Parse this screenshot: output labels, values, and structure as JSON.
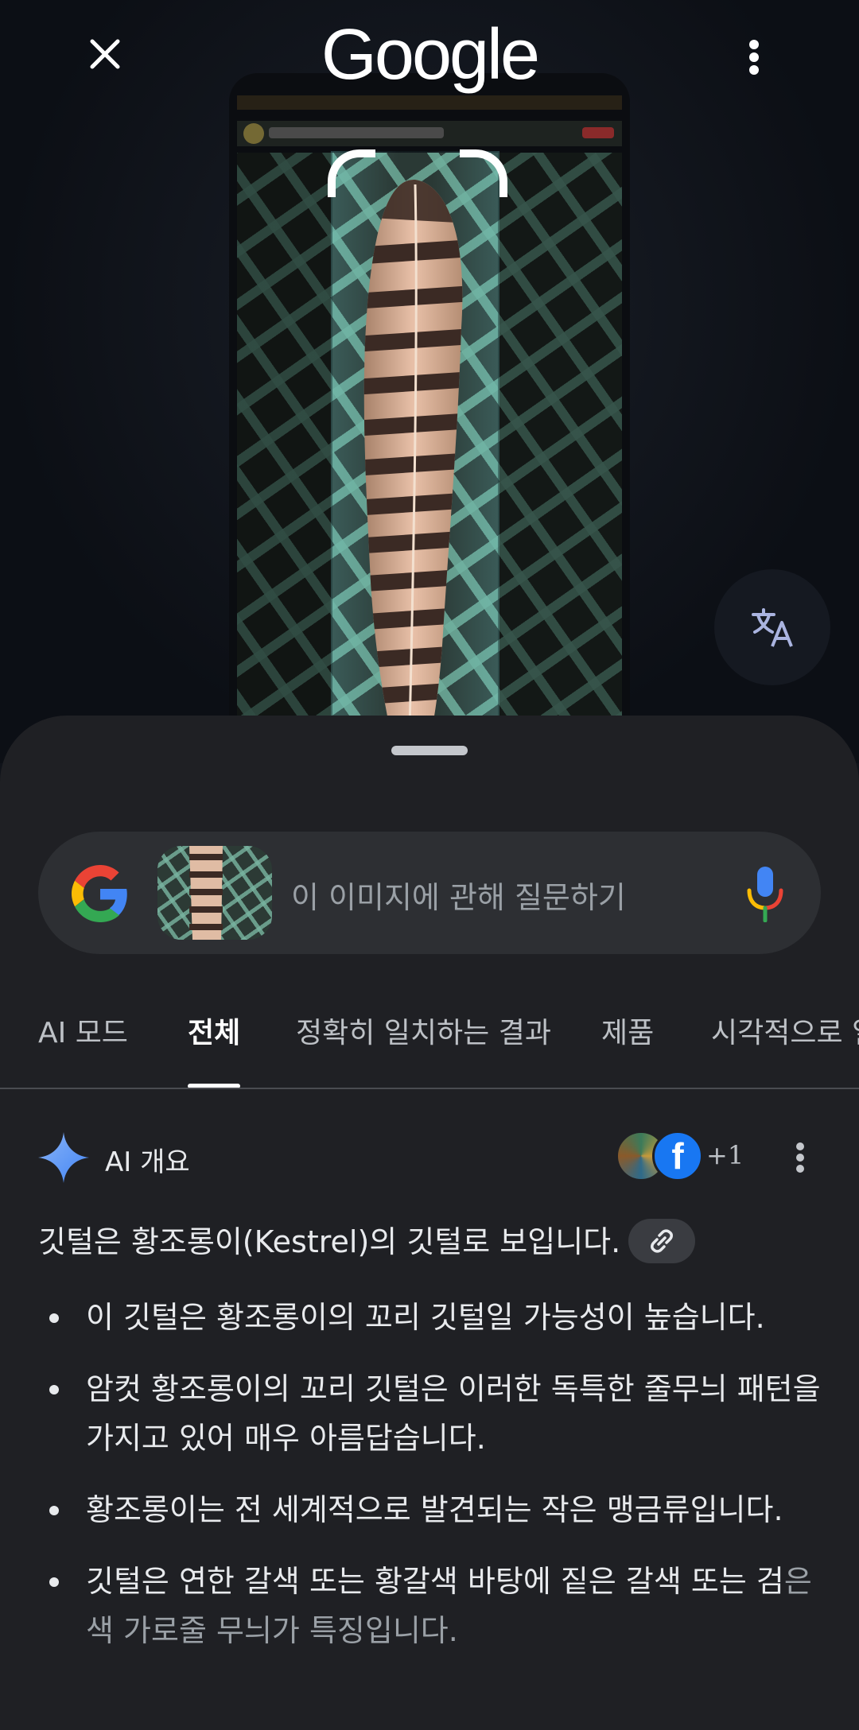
{
  "header": {
    "logo_text": "Google",
    "close_icon": "close-icon",
    "more_icon": "more-vert-icon"
  },
  "camera": {
    "translate_icon": "translate-icon"
  },
  "search": {
    "placeholder": "이 이미지에 관해 질문하기",
    "mic_icon": "mic-icon"
  },
  "tabs": [
    {
      "label": "AI 모드"
    },
    {
      "label": "전체",
      "active": true
    },
    {
      "label": "정확히 일치하는 결과"
    },
    {
      "label": "제품"
    },
    {
      "label": "시각적으로 일"
    }
  ],
  "ai_overview": {
    "title": "AI 개요",
    "source_count": "+1",
    "summary": "깃털은 황조롱이(Kestrel)의 깃털로 보입니다.",
    "bullets": [
      "이 깃털은 황조롱이의 꼬리 깃털일 가능성이 높습니다.",
      "암컷 황조롱이의 꼬리 깃털은 이러한 독특한 줄무늬 패턴을 가지고 있어 매우 아름답습니다.",
      "황조롱이는 전 세계적으로 발견되는 작은 맹금류입니다."
    ],
    "last_bullet_visible": "깃털은 연한 갈색 또는 황갈색 바탕에 짙은 갈색 또는 검",
    "last_bullet_faded": "은색 가로줄 무늬가 특징입니다."
  },
  "colors": {
    "accent_blue": "#1877f2",
    "background": "#1f2024",
    "camera_bg": "#10131a"
  }
}
